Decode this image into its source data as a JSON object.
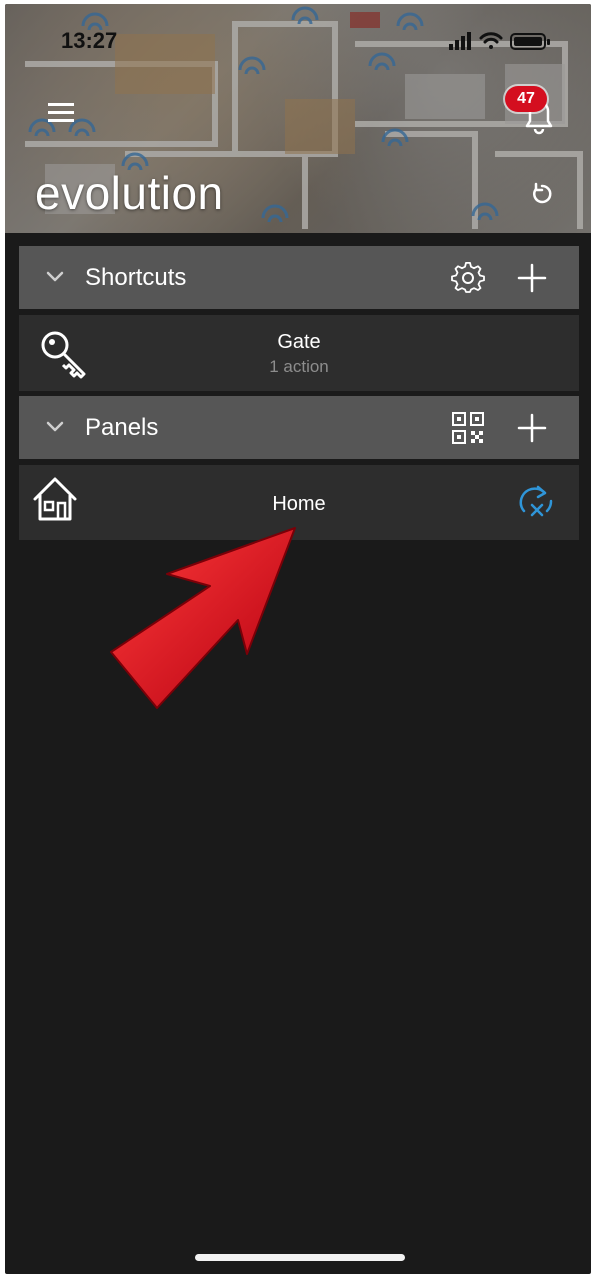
{
  "status_bar": {
    "time": "13:27"
  },
  "header": {
    "app_title": "evolution",
    "notification_count": "47",
    "icons": [
      "menu-icon",
      "bell-icon",
      "refresh-icon"
    ]
  },
  "shortcuts": {
    "label": "Shortcuts",
    "icons": [
      "chevron-down-icon",
      "gear-icon",
      "plus-icon"
    ],
    "items": [
      {
        "name": "Gate",
        "subtitle": "1 action",
        "icon": "key-icon"
      }
    ]
  },
  "panels": {
    "label": "Panels",
    "icons": [
      "chevron-down-icon",
      "qr-code-icon",
      "plus-icon"
    ],
    "items": [
      {
        "name": "Home",
        "icon": "house-icon",
        "status_icon": "sync-disconnected-icon"
      }
    ]
  },
  "colors": {
    "background": "#1a1a1a",
    "section_header": "#565656",
    "row": "#2d2d2d",
    "badge": "#d40e1f",
    "accent_blue": "#2f95d8",
    "annotation_arrow": "#e0101e"
  }
}
